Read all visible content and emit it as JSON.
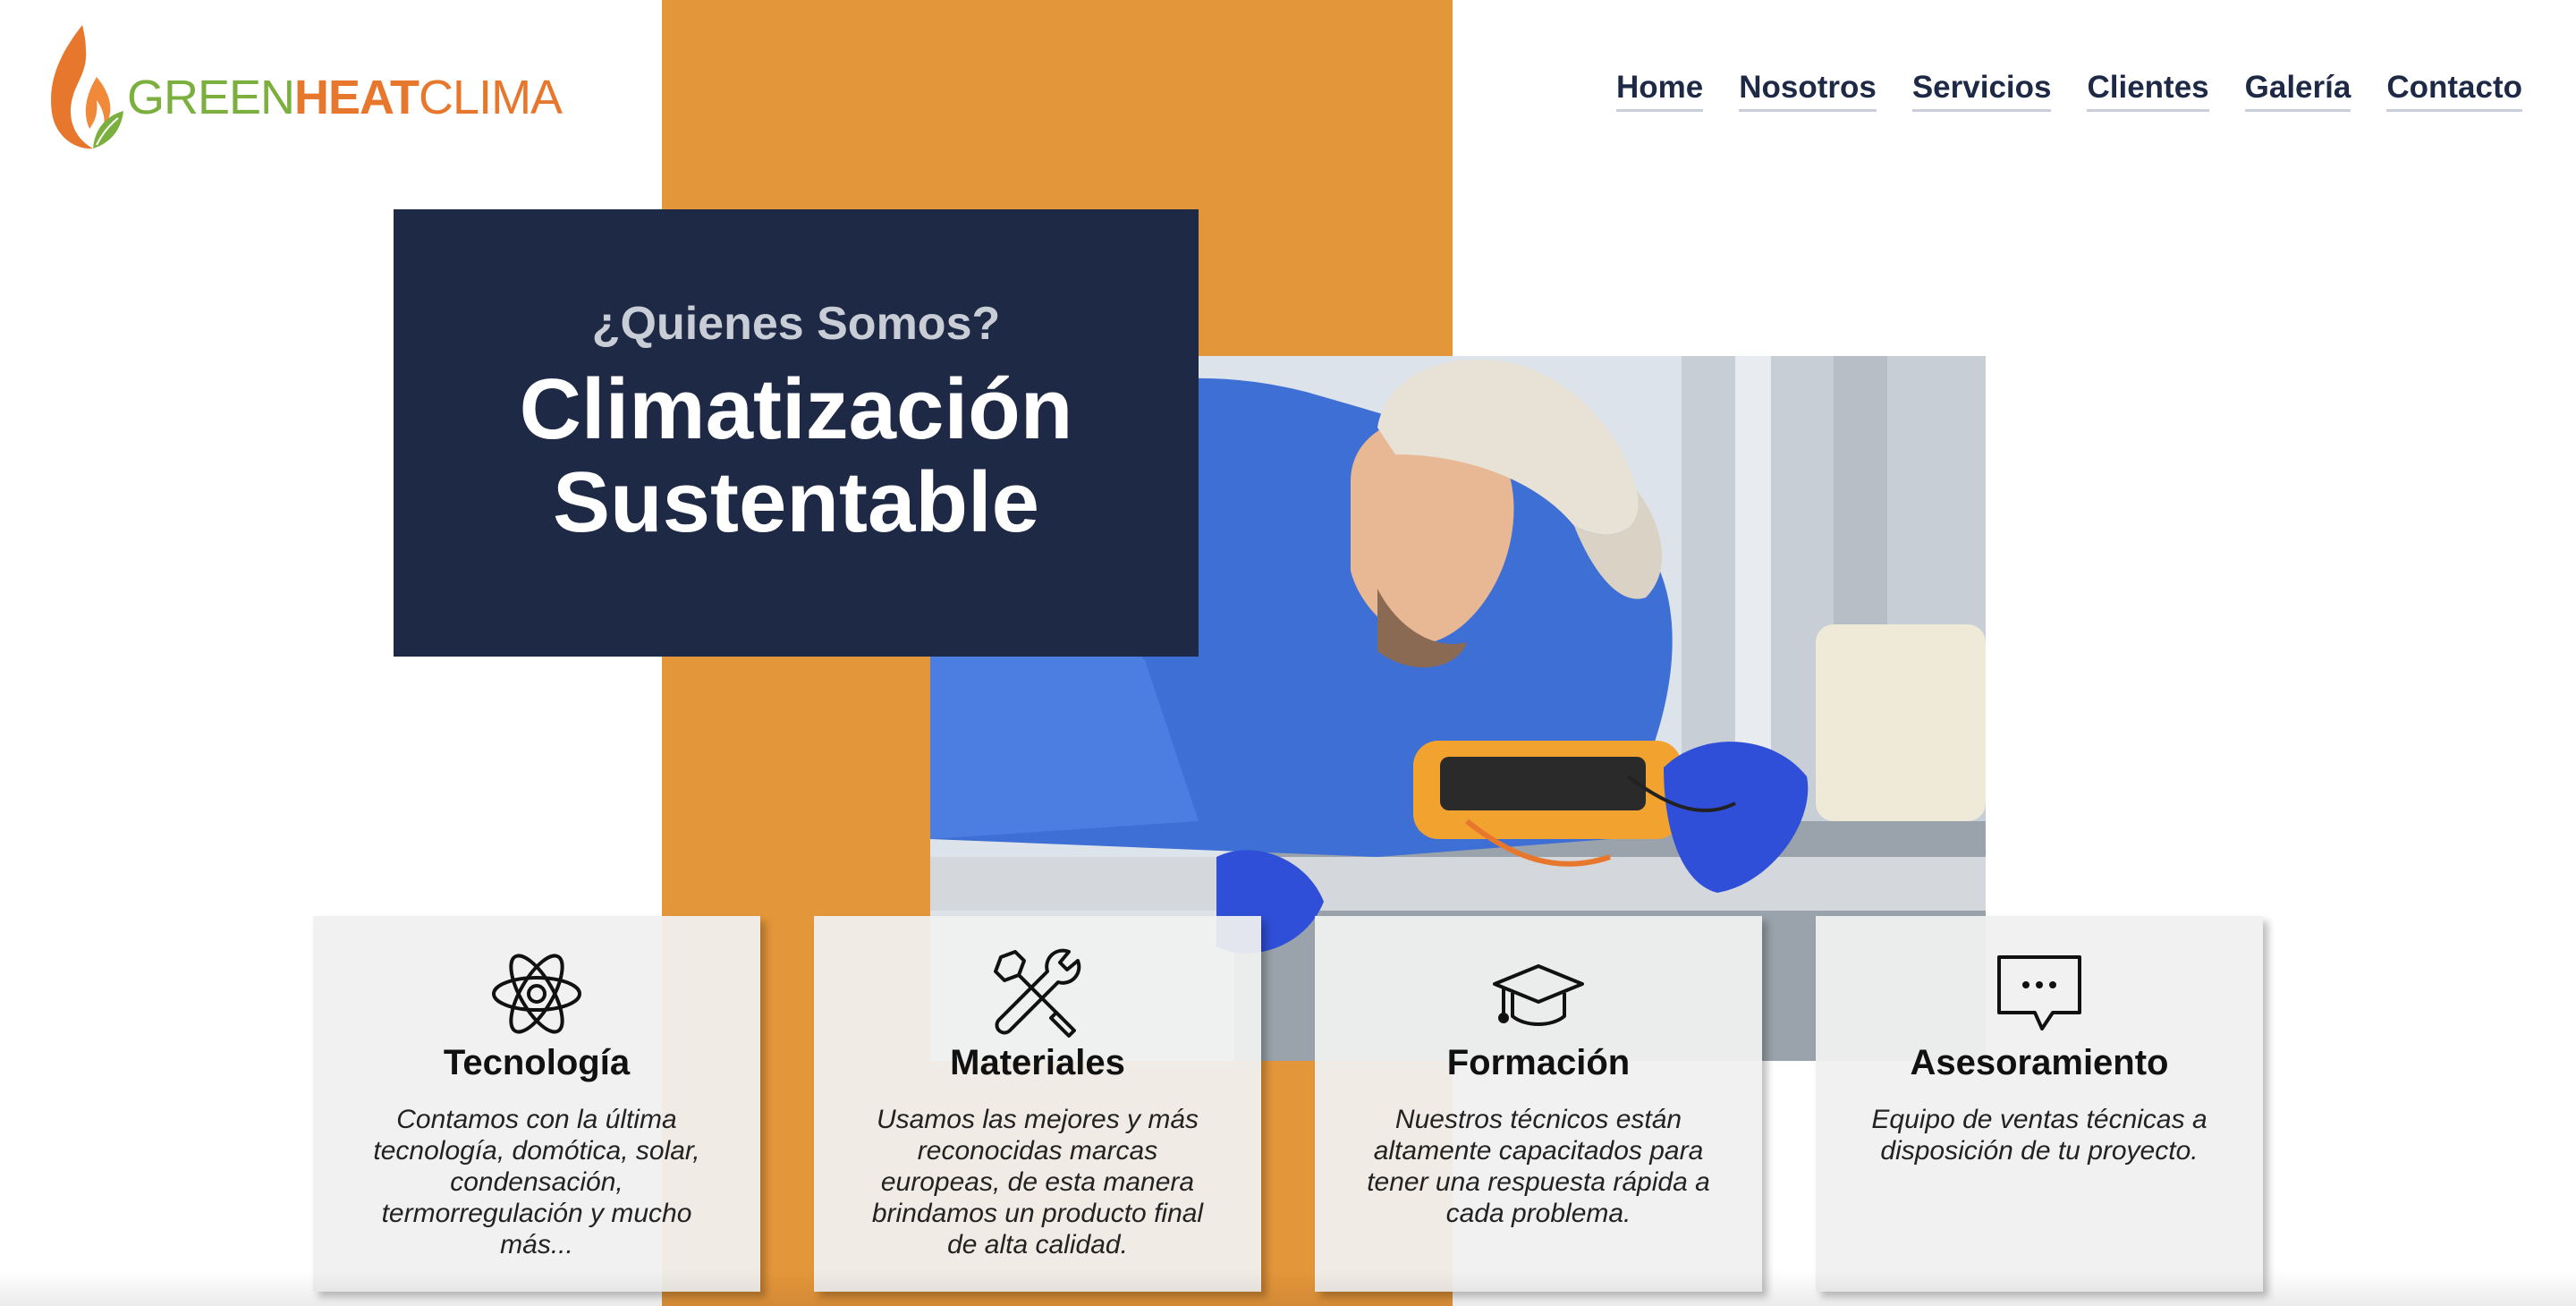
{
  "brand": {
    "logo_green": "GREEN",
    "logo_heat": "HEAT",
    "logo_clima": "CLIMA",
    "colors": {
      "navy": "#1E2A45",
      "orange": "#E4963A",
      "green": "#7BAF3E",
      "flame": "#E8772E"
    }
  },
  "nav": {
    "items": [
      {
        "label": "Home"
      },
      {
        "label": "Nosotros"
      },
      {
        "label": "Servicios"
      },
      {
        "label": "Clientes"
      },
      {
        "label": "Galería"
      },
      {
        "label": "Contacto"
      }
    ]
  },
  "hero": {
    "eyebrow": "¿Quienes Somos?",
    "headline": "Climatización Sustentable"
  },
  "features": [
    {
      "icon": "atom-icon",
      "title": "Tecnología",
      "text": "Contamos con la última tecnología, domótica, solar, condensación, termorregulación y mucho más..."
    },
    {
      "icon": "tools-icon",
      "title": "Materiales",
      "text": "Usamos las mejores y más reconocidas marcas europeas, de esta manera brindamos un producto final de alta calidad."
    },
    {
      "icon": "graduation-cap-icon",
      "title": "Formación",
      "text": "Nuestros técnicos están altamente capacitados para tener una respuesta rápida a cada problema."
    },
    {
      "icon": "chat-bubble-icon",
      "title": "Asesoramiento",
      "text": "Equipo de ventas técnicas a disposición de tu proyecto."
    }
  ]
}
